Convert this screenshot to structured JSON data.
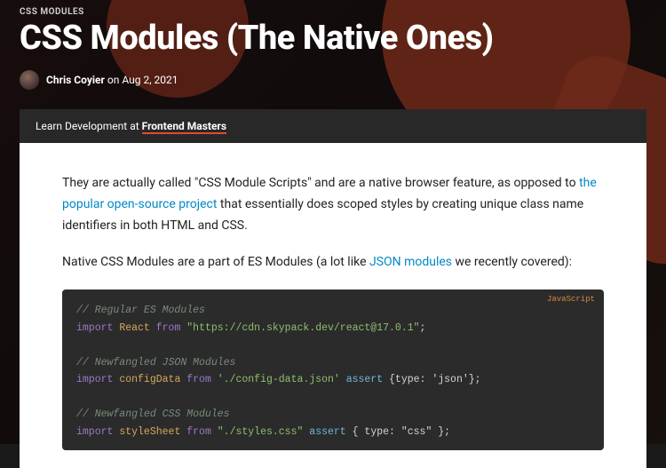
{
  "category": "CSS MODULES",
  "title": "CSS Modules (The Native Ones)",
  "author": "Chris Coyier",
  "date_prefix": " on ",
  "date": "Aug 2, 2021",
  "learn_bar": {
    "prefix": "Learn Development at ",
    "link_text": "Frontend Masters"
  },
  "article": {
    "p1_a": "They are actually called \"CSS Module Scripts\" and are a native browser feature, as opposed to ",
    "p1_link": "the popular open-source project",
    "p1_b": " that essentially does scoped styles by creating unique class name identifiers in both HTML and CSS.",
    "p2_a": "Native CSS Modules are a part of ES Modules (a lot like ",
    "p2_link": "JSON modules",
    "p2_b": " we recently covered):"
  },
  "code": {
    "lang": "JavaScript",
    "l1": "// Regular ES Modules",
    "l2_kw": "import",
    "l2_var": "React",
    "l2_from": "from",
    "l2_str": "\"https://cdn.skypack.dev/react@17.0.1\"",
    "l2_end": ";",
    "l3": "// Newfangled JSON Modules",
    "l4_kw": "import",
    "l4_var": "configData",
    "l4_from": "from",
    "l4_str": "'./config-data.json'",
    "l4_asrt": "assert",
    "l4_obj": "{type: 'json'}",
    "l4_end": ";",
    "l5": "// Newfangled CSS Modules",
    "l6_kw": "import",
    "l6_var": "styleSheet",
    "l6_from": "from",
    "l6_str": "\"./styles.css\"",
    "l6_asrt": "assert",
    "l6_obj": "{ type: \"css\" }",
    "l6_end": ";"
  }
}
